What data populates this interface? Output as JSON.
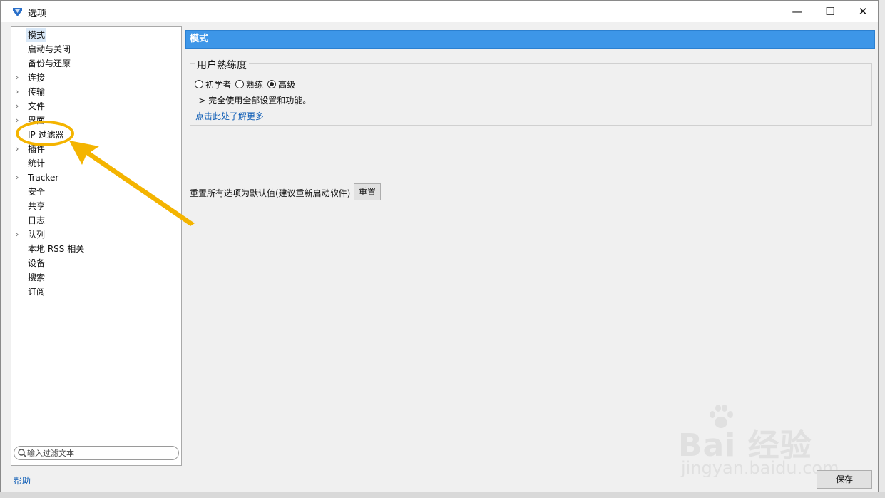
{
  "window": {
    "title": "选项",
    "min_glyph": "—",
    "max_glyph": "☐",
    "close_glyph": "✕"
  },
  "tree": {
    "items": [
      {
        "label": "模式",
        "expandable": false,
        "selected": true
      },
      {
        "label": "启动与关闭",
        "expandable": false
      },
      {
        "label": "备份与还原",
        "expandable": false
      },
      {
        "label": "连接",
        "expandable": true
      },
      {
        "label": "传输",
        "expandable": true
      },
      {
        "label": "文件",
        "expandable": true
      },
      {
        "label": "界面",
        "expandable": true
      },
      {
        "label": "IP 过滤器",
        "expandable": false
      },
      {
        "label": "插件",
        "expandable": true
      },
      {
        "label": "统计",
        "expandable": false
      },
      {
        "label": "Tracker",
        "expandable": true
      },
      {
        "label": "安全",
        "expandable": false
      },
      {
        "label": "共享",
        "expandable": false
      },
      {
        "label": "日志",
        "expandable": false
      },
      {
        "label": "队列",
        "expandable": true
      },
      {
        "label": "本地 RSS 相关",
        "expandable": false
      },
      {
        "label": "设备",
        "expandable": false
      },
      {
        "label": "搜索",
        "expandable": false
      },
      {
        "label": "订阅",
        "expandable": false
      }
    ],
    "filter_placeholder": "输入过滤文本",
    "help_label": "帮助"
  },
  "panel": {
    "header": "模式",
    "group_title": "用户熟练度",
    "options": [
      {
        "label": "初学者",
        "checked": false
      },
      {
        "label": "熟练",
        "checked": false
      },
      {
        "label": "高级",
        "checked": true
      }
    ],
    "description": "-> 完全使用全部设置和功能。",
    "learn_more": "点击此处了解更多",
    "reset_label": "重置所有选项为默认值(建议重新启动软件)",
    "reset_button": "重置",
    "save_button": "保存"
  },
  "watermark": {
    "brand": "Bai  经验",
    "url": "jingyan.baidu.com"
  },
  "colors": {
    "header_bg": "#3d96e8",
    "link": "#0b5bb5",
    "annotation": "#f4b400"
  }
}
